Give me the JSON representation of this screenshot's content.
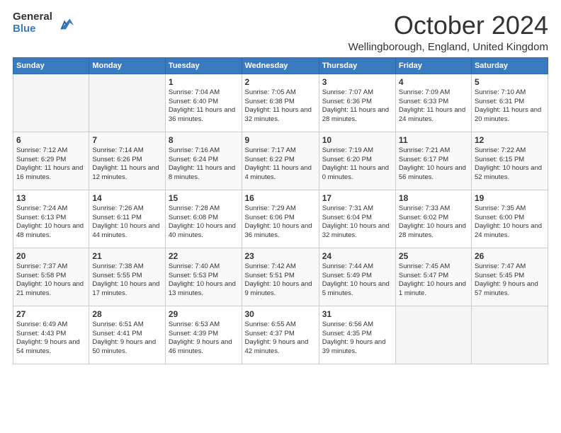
{
  "logo": {
    "general": "General",
    "blue": "Blue"
  },
  "header": {
    "month": "October 2024",
    "location": "Wellingborough, England, United Kingdom"
  },
  "weekdays": [
    "Sunday",
    "Monday",
    "Tuesday",
    "Wednesday",
    "Thursday",
    "Friday",
    "Saturday"
  ],
  "weeks": [
    [
      {
        "day": "",
        "sunrise": "",
        "sunset": "",
        "daylight": ""
      },
      {
        "day": "",
        "sunrise": "",
        "sunset": "",
        "daylight": ""
      },
      {
        "day": "1",
        "sunrise": "Sunrise: 7:04 AM",
        "sunset": "Sunset: 6:40 PM",
        "daylight": "Daylight: 11 hours and 36 minutes."
      },
      {
        "day": "2",
        "sunrise": "Sunrise: 7:05 AM",
        "sunset": "Sunset: 6:38 PM",
        "daylight": "Daylight: 11 hours and 32 minutes."
      },
      {
        "day": "3",
        "sunrise": "Sunrise: 7:07 AM",
        "sunset": "Sunset: 6:36 PM",
        "daylight": "Daylight: 11 hours and 28 minutes."
      },
      {
        "day": "4",
        "sunrise": "Sunrise: 7:09 AM",
        "sunset": "Sunset: 6:33 PM",
        "daylight": "Daylight: 11 hours and 24 minutes."
      },
      {
        "day": "5",
        "sunrise": "Sunrise: 7:10 AM",
        "sunset": "Sunset: 6:31 PM",
        "daylight": "Daylight: 11 hours and 20 minutes."
      }
    ],
    [
      {
        "day": "6",
        "sunrise": "Sunrise: 7:12 AM",
        "sunset": "Sunset: 6:29 PM",
        "daylight": "Daylight: 11 hours and 16 minutes."
      },
      {
        "day": "7",
        "sunrise": "Sunrise: 7:14 AM",
        "sunset": "Sunset: 6:26 PM",
        "daylight": "Daylight: 11 hours and 12 minutes."
      },
      {
        "day": "8",
        "sunrise": "Sunrise: 7:16 AM",
        "sunset": "Sunset: 6:24 PM",
        "daylight": "Daylight: 11 hours and 8 minutes."
      },
      {
        "day": "9",
        "sunrise": "Sunrise: 7:17 AM",
        "sunset": "Sunset: 6:22 PM",
        "daylight": "Daylight: 11 hours and 4 minutes."
      },
      {
        "day": "10",
        "sunrise": "Sunrise: 7:19 AM",
        "sunset": "Sunset: 6:20 PM",
        "daylight": "Daylight: 11 hours and 0 minutes."
      },
      {
        "day": "11",
        "sunrise": "Sunrise: 7:21 AM",
        "sunset": "Sunset: 6:17 PM",
        "daylight": "Daylight: 10 hours and 56 minutes."
      },
      {
        "day": "12",
        "sunrise": "Sunrise: 7:22 AM",
        "sunset": "Sunset: 6:15 PM",
        "daylight": "Daylight: 10 hours and 52 minutes."
      }
    ],
    [
      {
        "day": "13",
        "sunrise": "Sunrise: 7:24 AM",
        "sunset": "Sunset: 6:13 PM",
        "daylight": "Daylight: 10 hours and 48 minutes."
      },
      {
        "day": "14",
        "sunrise": "Sunrise: 7:26 AM",
        "sunset": "Sunset: 6:11 PM",
        "daylight": "Daylight: 10 hours and 44 minutes."
      },
      {
        "day": "15",
        "sunrise": "Sunrise: 7:28 AM",
        "sunset": "Sunset: 6:08 PM",
        "daylight": "Daylight: 10 hours and 40 minutes."
      },
      {
        "day": "16",
        "sunrise": "Sunrise: 7:29 AM",
        "sunset": "Sunset: 6:06 PM",
        "daylight": "Daylight: 10 hours and 36 minutes."
      },
      {
        "day": "17",
        "sunrise": "Sunrise: 7:31 AM",
        "sunset": "Sunset: 6:04 PM",
        "daylight": "Daylight: 10 hours and 32 minutes."
      },
      {
        "day": "18",
        "sunrise": "Sunrise: 7:33 AM",
        "sunset": "Sunset: 6:02 PM",
        "daylight": "Daylight: 10 hours and 28 minutes."
      },
      {
        "day": "19",
        "sunrise": "Sunrise: 7:35 AM",
        "sunset": "Sunset: 6:00 PM",
        "daylight": "Daylight: 10 hours and 24 minutes."
      }
    ],
    [
      {
        "day": "20",
        "sunrise": "Sunrise: 7:37 AM",
        "sunset": "Sunset: 5:58 PM",
        "daylight": "Daylight: 10 hours and 21 minutes."
      },
      {
        "day": "21",
        "sunrise": "Sunrise: 7:38 AM",
        "sunset": "Sunset: 5:55 PM",
        "daylight": "Daylight: 10 hours and 17 minutes."
      },
      {
        "day": "22",
        "sunrise": "Sunrise: 7:40 AM",
        "sunset": "Sunset: 5:53 PM",
        "daylight": "Daylight: 10 hours and 13 minutes."
      },
      {
        "day": "23",
        "sunrise": "Sunrise: 7:42 AM",
        "sunset": "Sunset: 5:51 PM",
        "daylight": "Daylight: 10 hours and 9 minutes."
      },
      {
        "day": "24",
        "sunrise": "Sunrise: 7:44 AM",
        "sunset": "Sunset: 5:49 PM",
        "daylight": "Daylight: 10 hours and 5 minutes."
      },
      {
        "day": "25",
        "sunrise": "Sunrise: 7:45 AM",
        "sunset": "Sunset: 5:47 PM",
        "daylight": "Daylight: 10 hours and 1 minute."
      },
      {
        "day": "26",
        "sunrise": "Sunrise: 7:47 AM",
        "sunset": "Sunset: 5:45 PM",
        "daylight": "Daylight: 9 hours and 57 minutes."
      }
    ],
    [
      {
        "day": "27",
        "sunrise": "Sunrise: 6:49 AM",
        "sunset": "Sunset: 4:43 PM",
        "daylight": "Daylight: 9 hours and 54 minutes."
      },
      {
        "day": "28",
        "sunrise": "Sunrise: 6:51 AM",
        "sunset": "Sunset: 4:41 PM",
        "daylight": "Daylight: 9 hours and 50 minutes."
      },
      {
        "day": "29",
        "sunrise": "Sunrise: 6:53 AM",
        "sunset": "Sunset: 4:39 PM",
        "daylight": "Daylight: 9 hours and 46 minutes."
      },
      {
        "day": "30",
        "sunrise": "Sunrise: 6:55 AM",
        "sunset": "Sunset: 4:37 PM",
        "daylight": "Daylight: 9 hours and 42 minutes."
      },
      {
        "day": "31",
        "sunrise": "Sunrise: 6:56 AM",
        "sunset": "Sunset: 4:35 PM",
        "daylight": "Daylight: 9 hours and 39 minutes."
      },
      {
        "day": "",
        "sunrise": "",
        "sunset": "",
        "daylight": ""
      },
      {
        "day": "",
        "sunrise": "",
        "sunset": "",
        "daylight": ""
      }
    ]
  ]
}
